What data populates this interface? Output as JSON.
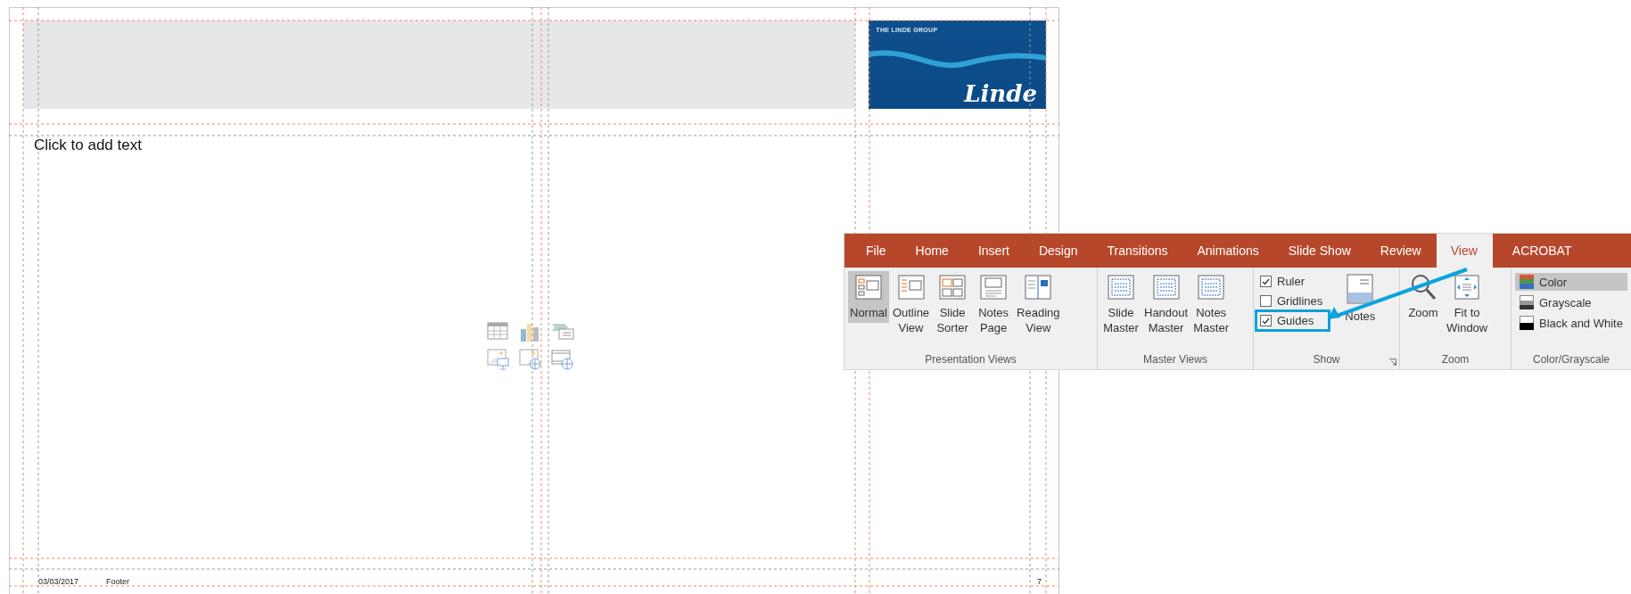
{
  "slide": {
    "logo": {
      "caption": "THE LINDE GROUP",
      "wordmark": "Linde"
    },
    "body_placeholder": "Click to add text",
    "footer": {
      "date": "03/03/2017",
      "text": "Footer",
      "page_number": "7"
    }
  },
  "ribbon": {
    "tabs": [
      {
        "label": "File",
        "selected": false
      },
      {
        "label": "Home",
        "selected": false
      },
      {
        "label": "Insert",
        "selected": false
      },
      {
        "label": "Design",
        "selected": false
      },
      {
        "label": "Transitions",
        "selected": false
      },
      {
        "label": "Animations",
        "selected": false
      },
      {
        "label": "Slide Show",
        "selected": false
      },
      {
        "label": "Review",
        "selected": false
      },
      {
        "label": "View",
        "selected": true
      },
      {
        "label": "ACROBAT",
        "selected": false
      }
    ],
    "presentation_views": {
      "label": "Presentation Views",
      "buttons": [
        {
          "lines": [
            "Normal"
          ],
          "selected": true
        },
        {
          "lines": [
            "Outline",
            "View"
          ],
          "selected": false
        },
        {
          "lines": [
            "Slide",
            "Sorter"
          ],
          "selected": false
        },
        {
          "lines": [
            "Notes",
            "Page"
          ],
          "selected": false
        },
        {
          "lines": [
            "Reading",
            "View"
          ],
          "selected": false
        }
      ]
    },
    "master_views": {
      "label": "Master Views",
      "buttons": [
        {
          "lines": [
            "Slide",
            "Master"
          ]
        },
        {
          "lines": [
            "Handout",
            "Master"
          ]
        },
        {
          "lines": [
            "Notes",
            "Master"
          ]
        }
      ]
    },
    "show": {
      "label": "Show",
      "checkboxes": [
        {
          "label": "Ruler",
          "checked": true,
          "highlighted": false
        },
        {
          "label": "Gridlines",
          "checked": false,
          "highlighted": false
        },
        {
          "label": "Guides",
          "checked": true,
          "highlighted": true
        }
      ],
      "button": {
        "lines": [
          "Notes"
        ]
      }
    },
    "zoom": {
      "label": "Zoom",
      "buttons": [
        {
          "lines": [
            "Zoom"
          ]
        },
        {
          "lines": [
            "Fit to",
            "Window"
          ]
        }
      ]
    },
    "color_grayscale": {
      "label": "Color/Grayscale",
      "options": [
        {
          "label": "Color",
          "selected": true
        },
        {
          "label": "Grayscale",
          "selected": false
        },
        {
          "label": "Black and White",
          "selected": false
        }
      ]
    }
  }
}
